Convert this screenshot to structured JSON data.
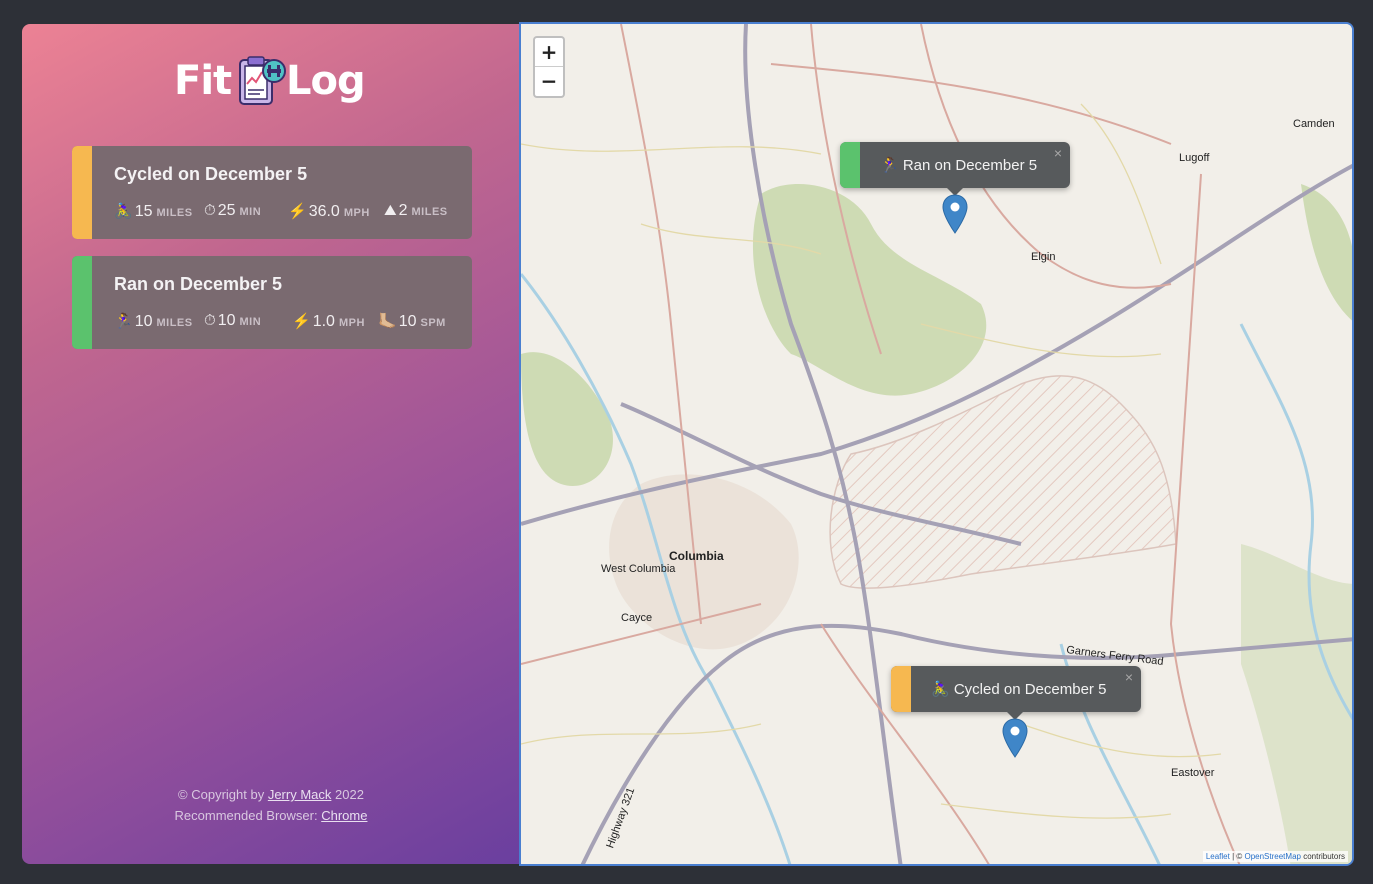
{
  "logo": {
    "part1": "Fit",
    "part2": "Log"
  },
  "workouts": [
    {
      "title": "Cycled on December 5",
      "type_color": "#f6b850",
      "details": [
        {
          "icon": "🚴‍♀️",
          "value": "15",
          "unit": "MILES"
        },
        {
          "icon": "⏱",
          "value": "25",
          "unit": "MIN"
        },
        {
          "icon": "⚡️",
          "value": "36.0",
          "unit": "MPH"
        },
        {
          "icon": "⛰",
          "value": "2",
          "unit": "MILES"
        }
      ]
    },
    {
      "title": "Ran on December 5",
      "type_color": "#5bc26d",
      "details": [
        {
          "icon": "🏃‍♀️",
          "value": "10",
          "unit": "MILES"
        },
        {
          "icon": "⏱",
          "value": "10",
          "unit": "MIN"
        },
        {
          "icon": "⚡️",
          "value": "1.0",
          "unit": "MPH"
        },
        {
          "icon": "🦶🏼",
          "value": "10",
          "unit": "SPM"
        }
      ]
    }
  ],
  "footer": {
    "copyright_prefix": "© Copyright by ",
    "author": "Jerry Mack",
    "year": " 2022",
    "browser_prefix": "Recommended Browser: ",
    "browser": "Chrome"
  },
  "map": {
    "zoom_in": "+",
    "zoom_out": "−",
    "popups": [
      {
        "text": "🏃‍♀️ Ran on December 5",
        "color": "#5bc26d"
      },
      {
        "text": "🚴‍♀️ Cycled on December 5",
        "color": "#f6b850"
      }
    ],
    "close": "×",
    "places": [
      "Camden",
      "Lugoff",
      "Elgin",
      "Columbia",
      "West Columbia",
      "Cayce",
      "Garners Ferry Road",
      "Eastover",
      "Highway 321"
    ],
    "attribution": {
      "leaflet": "Leaflet",
      "sep": " | © ",
      "osm": "OpenStreetMap",
      "suffix": " contributors"
    },
    "marker_color": "#3f86c8"
  }
}
